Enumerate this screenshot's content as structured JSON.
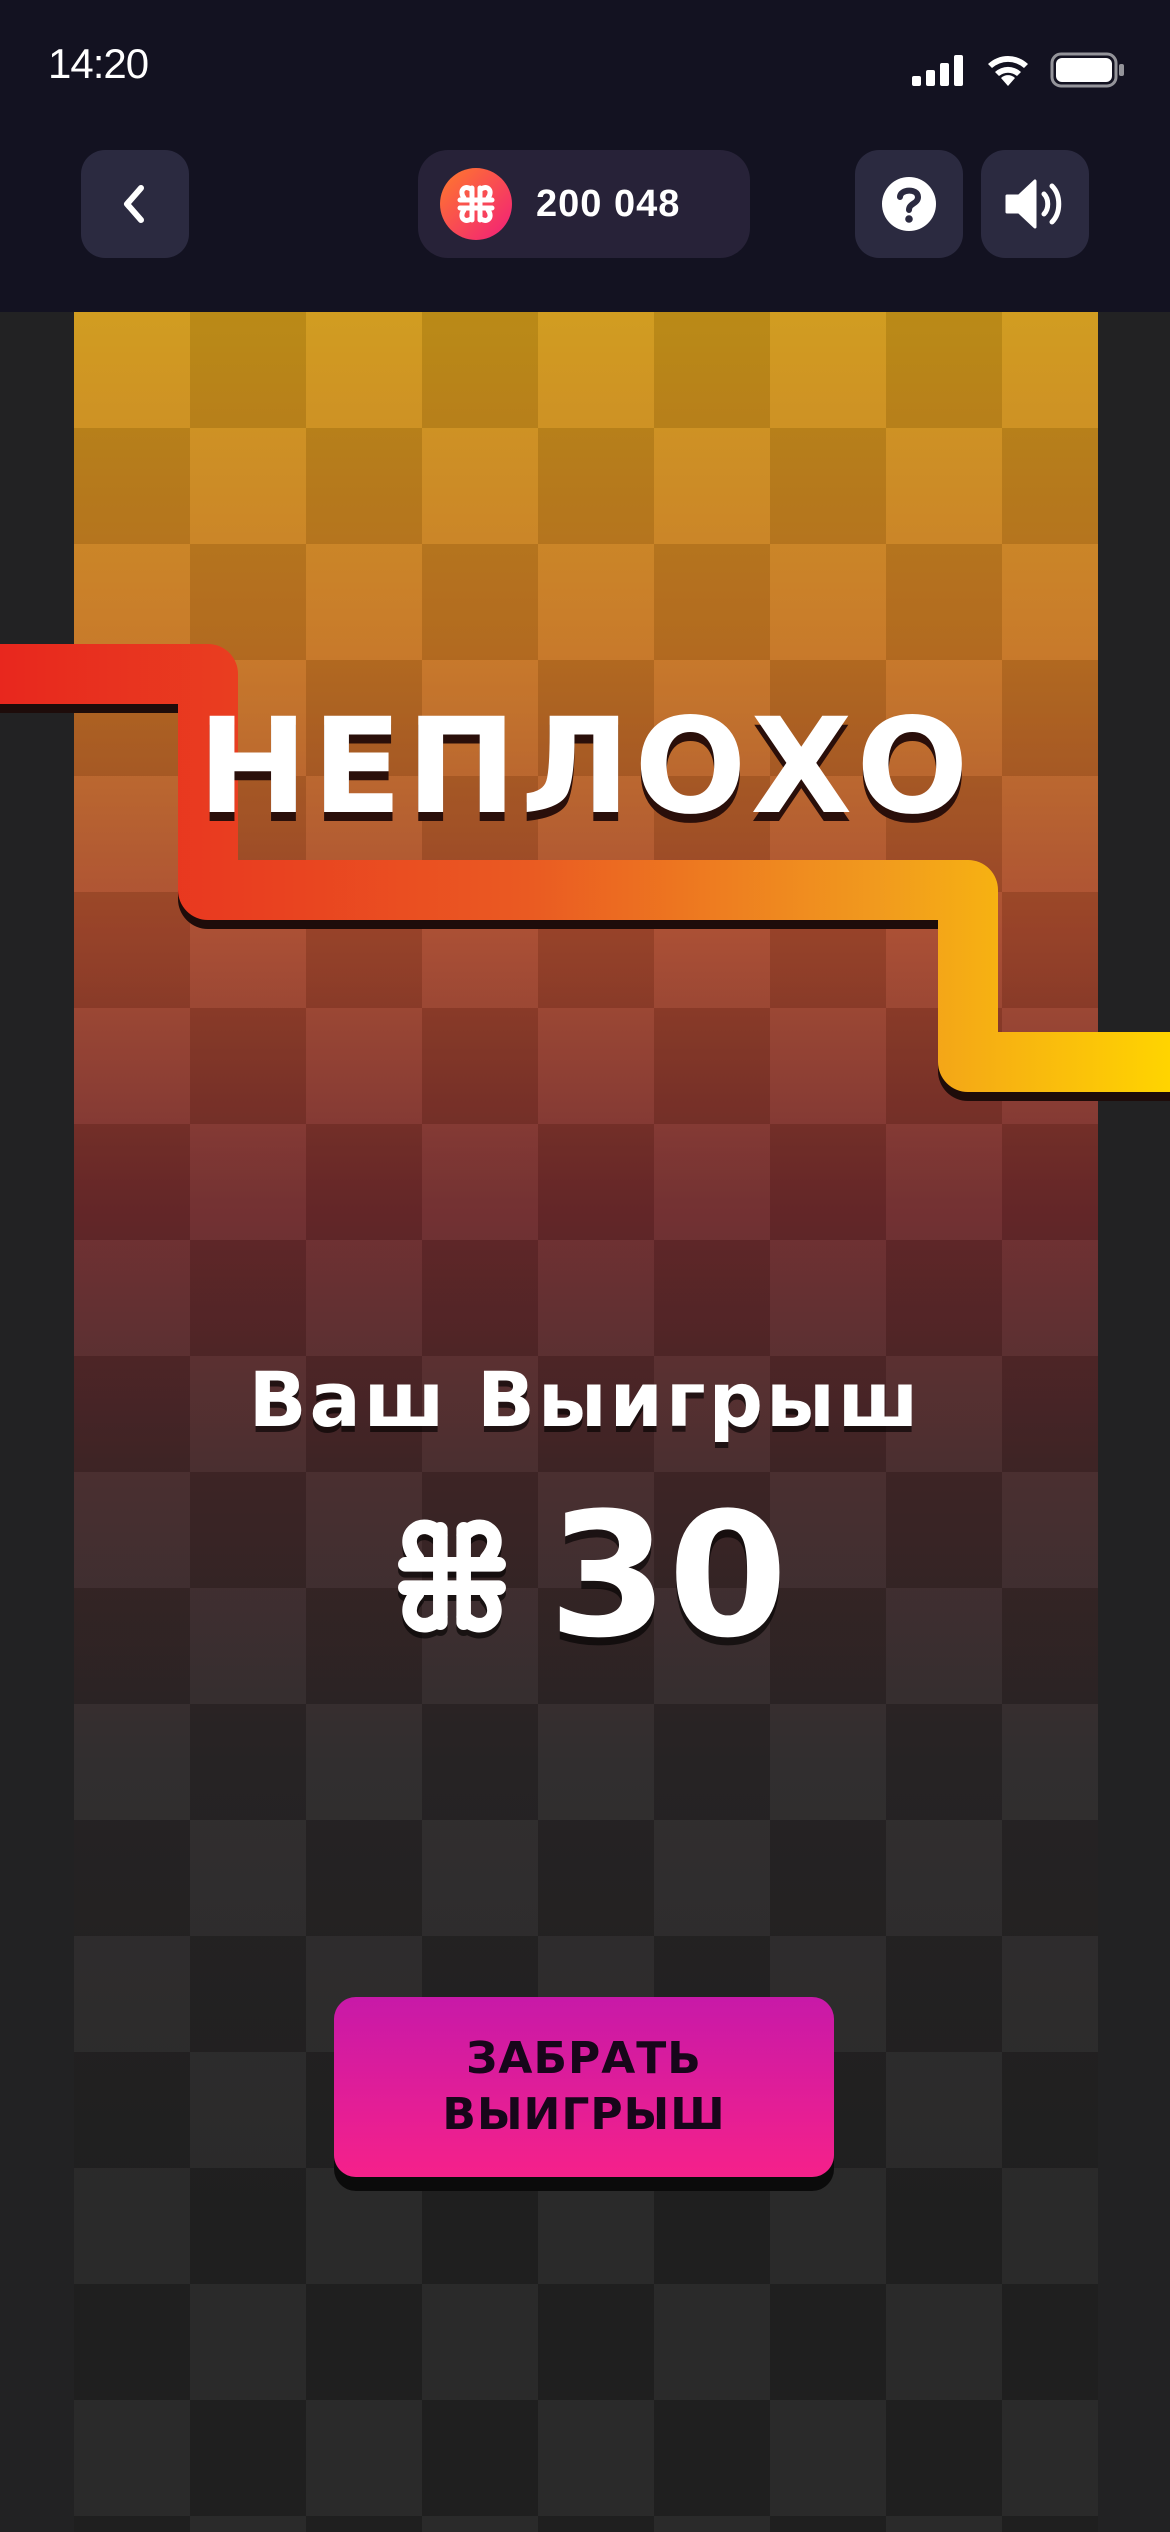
{
  "status_bar": {
    "time": "14:20",
    "icons": [
      "signal-icon",
      "wifi-icon",
      "battery-icon"
    ]
  },
  "top_bar": {
    "back_icon": "chevron-left-icon",
    "balance": "200 048",
    "balance_icon": "coin-icon",
    "help_icon": "question-icon",
    "sound_icon": "speaker-icon"
  },
  "game": {
    "result_title": "НЕПЛОХО",
    "win_label": "Ваш Выигрыш",
    "win_amount": "30",
    "currency_icon": "coin-symbol-icon",
    "claim_button": "ЗАБРАТЬ\nВЫИГРЫШ"
  },
  "colors": {
    "accent_pink": "#f5218a",
    "accent_magenta": "#c819a8",
    "snake_start": "#e8271e",
    "snake_end": "#ffd400",
    "header_bg": "#131221",
    "button_bg": "#2b2a40"
  }
}
